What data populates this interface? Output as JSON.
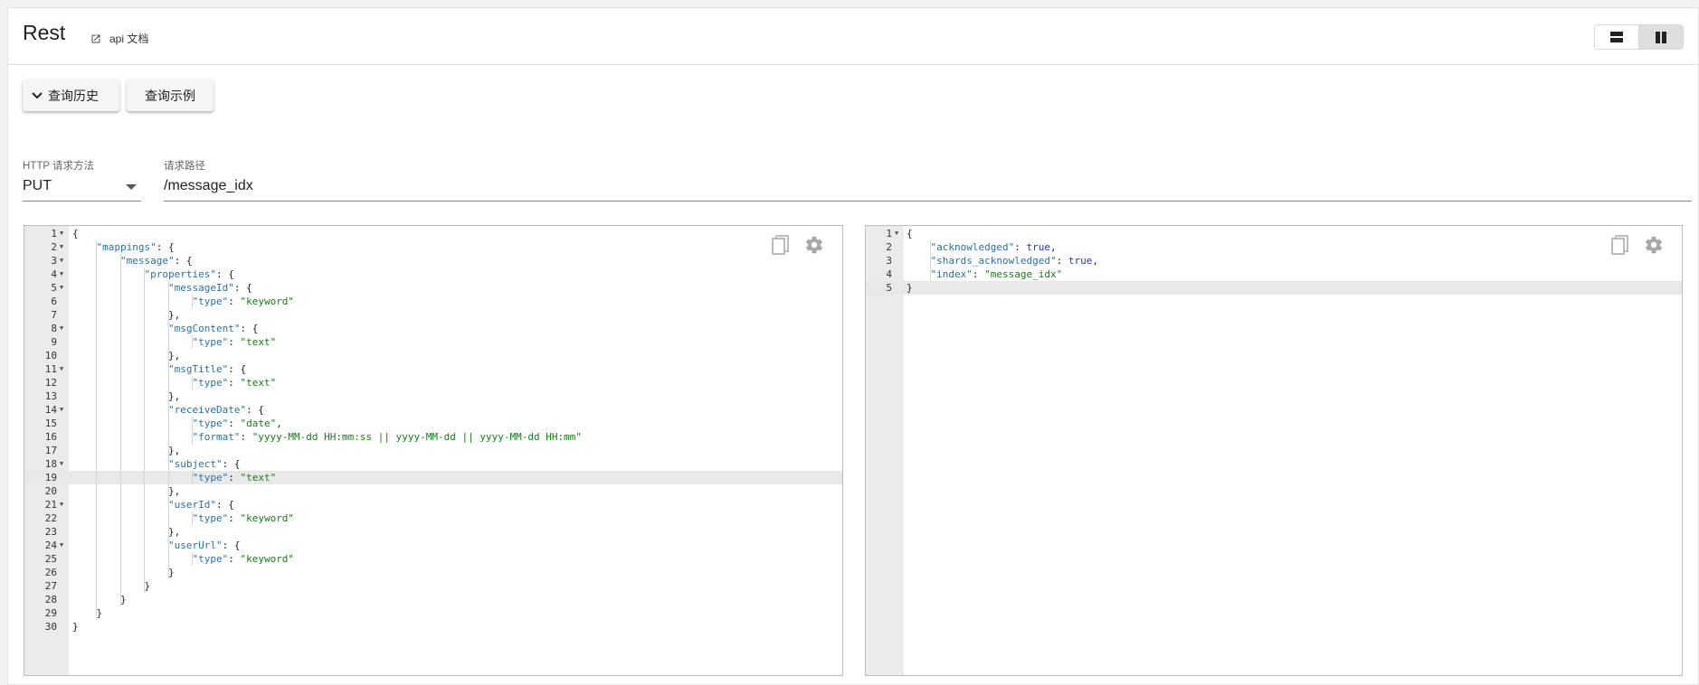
{
  "header": {
    "title": "Rest",
    "doc_link": "api 文档",
    "view_toggle": {
      "options": [
        "stacked-layout-icon",
        "side-by-side-layout-icon"
      ],
      "active": "side-by-side-layout-icon"
    }
  },
  "toolbar": {
    "history_label": "查询历史",
    "example_label": "查询示例"
  },
  "request": {
    "method_label": "HTTP 请求方法",
    "method_value": "PUT",
    "path_label": "请求路径",
    "path_value": "/message_idx"
  },
  "request_editor": {
    "active_line": 19,
    "lines": [
      {
        "n": 1,
        "fold": true,
        "indent": 0,
        "parts": [
          [
            "p",
            "{"
          ]
        ]
      },
      {
        "n": 2,
        "fold": true,
        "indent": 1,
        "parts": [
          [
            "k",
            "\"mappings\""
          ],
          [
            "p",
            ": {"
          ]
        ]
      },
      {
        "n": 3,
        "fold": true,
        "indent": 2,
        "parts": [
          [
            "k",
            "\"message\""
          ],
          [
            "p",
            ": {"
          ]
        ]
      },
      {
        "n": 4,
        "fold": true,
        "indent": 3,
        "parts": [
          [
            "k",
            "\"properties\""
          ],
          [
            "p",
            ": {"
          ]
        ]
      },
      {
        "n": 5,
        "fold": true,
        "indent": 4,
        "parts": [
          [
            "k",
            "\"messageId\""
          ],
          [
            "p",
            ": {"
          ]
        ]
      },
      {
        "n": 6,
        "fold": false,
        "indent": 5,
        "parts": [
          [
            "k",
            "\"type\""
          ],
          [
            "p",
            ": "
          ],
          [
            "s",
            "\"keyword\""
          ]
        ]
      },
      {
        "n": 7,
        "fold": false,
        "indent": 4,
        "parts": [
          [
            "p",
            "},"
          ]
        ]
      },
      {
        "n": 8,
        "fold": true,
        "indent": 4,
        "parts": [
          [
            "k",
            "\"msgContent\""
          ],
          [
            "p",
            ": {"
          ]
        ]
      },
      {
        "n": 9,
        "fold": false,
        "indent": 5,
        "parts": [
          [
            "k",
            "\"type\""
          ],
          [
            "p",
            ": "
          ],
          [
            "s",
            "\"text\""
          ]
        ]
      },
      {
        "n": 10,
        "fold": false,
        "indent": 4,
        "parts": [
          [
            "p",
            "},"
          ]
        ]
      },
      {
        "n": 11,
        "fold": true,
        "indent": 4,
        "parts": [
          [
            "k",
            "\"msgTitle\""
          ],
          [
            "p",
            ": {"
          ]
        ]
      },
      {
        "n": 12,
        "fold": false,
        "indent": 5,
        "parts": [
          [
            "k",
            "\"type\""
          ],
          [
            "p",
            ": "
          ],
          [
            "s",
            "\"text\""
          ]
        ]
      },
      {
        "n": 13,
        "fold": false,
        "indent": 4,
        "parts": [
          [
            "p",
            "},"
          ]
        ]
      },
      {
        "n": 14,
        "fold": true,
        "indent": 4,
        "parts": [
          [
            "k",
            "\"receiveDate\""
          ],
          [
            "p",
            ": {"
          ]
        ]
      },
      {
        "n": 15,
        "fold": false,
        "indent": 5,
        "parts": [
          [
            "k",
            "\"type\""
          ],
          [
            "p",
            ": "
          ],
          [
            "s",
            "\"date\""
          ],
          [
            "p",
            ","
          ]
        ]
      },
      {
        "n": 16,
        "fold": false,
        "indent": 5,
        "parts": [
          [
            "k",
            "\"format\""
          ],
          [
            "p",
            ": "
          ],
          [
            "s",
            "\"yyyy-MM-dd HH:mm:ss || yyyy-MM-dd || yyyy-MM-dd HH:mm\""
          ]
        ]
      },
      {
        "n": 17,
        "fold": false,
        "indent": 4,
        "parts": [
          [
            "p",
            "},"
          ]
        ]
      },
      {
        "n": 18,
        "fold": true,
        "indent": 4,
        "parts": [
          [
            "k",
            "\"subject\""
          ],
          [
            "p",
            ": {"
          ]
        ]
      },
      {
        "n": 19,
        "fold": false,
        "indent": 5,
        "parts": [
          [
            "k",
            "\"type\""
          ],
          [
            "p",
            ": "
          ],
          [
            "s",
            "\"text\""
          ]
        ]
      },
      {
        "n": 20,
        "fold": false,
        "indent": 4,
        "parts": [
          [
            "p",
            "},"
          ]
        ]
      },
      {
        "n": 21,
        "fold": true,
        "indent": 4,
        "parts": [
          [
            "k",
            "\"userId\""
          ],
          [
            "p",
            ": {"
          ]
        ]
      },
      {
        "n": 22,
        "fold": false,
        "indent": 5,
        "parts": [
          [
            "k",
            "\"type\""
          ],
          [
            "p",
            ": "
          ],
          [
            "s",
            "\"keyword\""
          ]
        ]
      },
      {
        "n": 23,
        "fold": false,
        "indent": 4,
        "parts": [
          [
            "p",
            "},"
          ]
        ]
      },
      {
        "n": 24,
        "fold": true,
        "indent": 4,
        "parts": [
          [
            "k",
            "\"userUrl\""
          ],
          [
            "p",
            ": {"
          ]
        ]
      },
      {
        "n": 25,
        "fold": false,
        "indent": 5,
        "parts": [
          [
            "k",
            "\"type\""
          ],
          [
            "p",
            ": "
          ],
          [
            "s",
            "\"keyword\""
          ]
        ]
      },
      {
        "n": 26,
        "fold": false,
        "indent": 4,
        "parts": [
          [
            "p",
            "}"
          ]
        ]
      },
      {
        "n": 27,
        "fold": false,
        "indent": 3,
        "parts": [
          [
            "p",
            "}"
          ]
        ]
      },
      {
        "n": 28,
        "fold": false,
        "indent": 2,
        "parts": [
          [
            "p",
            "}"
          ]
        ]
      },
      {
        "n": 29,
        "fold": false,
        "indent": 1,
        "parts": [
          [
            "p",
            "}"
          ]
        ]
      },
      {
        "n": 30,
        "fold": false,
        "indent": 0,
        "parts": [
          [
            "p",
            "}"
          ]
        ]
      }
    ]
  },
  "response_editor": {
    "active_line": 5,
    "lines": [
      {
        "n": 1,
        "fold": true,
        "indent": 0,
        "parts": [
          [
            "p",
            "{"
          ]
        ]
      },
      {
        "n": 2,
        "fold": false,
        "indent": 1,
        "parts": [
          [
            "k",
            "\"acknowledged\""
          ],
          [
            "p",
            ": "
          ],
          [
            "b",
            "true"
          ],
          [
            "p",
            ","
          ]
        ]
      },
      {
        "n": 3,
        "fold": false,
        "indent": 1,
        "parts": [
          [
            "k",
            "\"shards_acknowledged\""
          ],
          [
            "p",
            ": "
          ],
          [
            "b",
            "true"
          ],
          [
            "p",
            ","
          ]
        ]
      },
      {
        "n": 4,
        "fold": false,
        "indent": 1,
        "parts": [
          [
            "k",
            "\"index\""
          ],
          [
            "p",
            ": "
          ],
          [
            "s",
            "\"message_idx\""
          ]
        ]
      },
      {
        "n": 5,
        "fold": false,
        "indent": 0,
        "parts": [
          [
            "p",
            "}"
          ]
        ]
      }
    ]
  },
  "editor_icons": [
    "copy-icon",
    "gear-icon"
  ]
}
